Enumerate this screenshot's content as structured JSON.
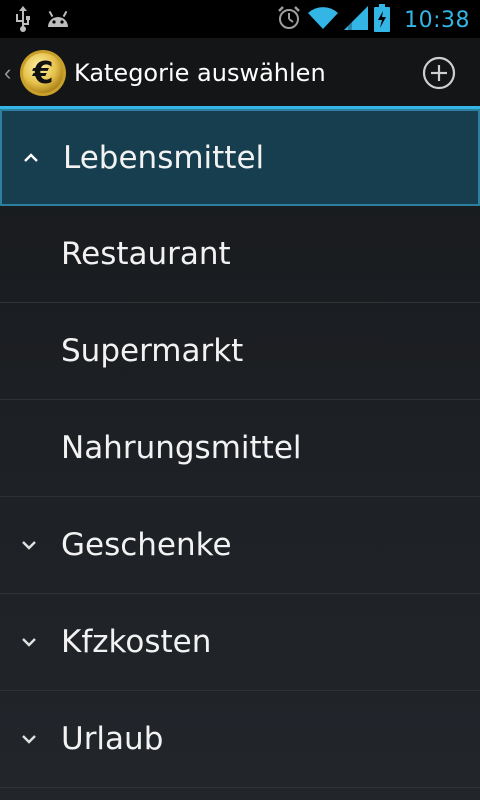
{
  "status_bar": {
    "time": "10:38",
    "left_icons": [
      "usb-icon",
      "android-icon"
    ],
    "right_icons": [
      "alarm-icon",
      "wifi-icon",
      "signal-icon",
      "battery-charging-icon"
    ]
  },
  "action_bar": {
    "title": "Kategorie auswählen",
    "app_icon": "euro-coin-icon",
    "add_icon": "add-circle-icon"
  },
  "categories": [
    {
      "label": "Lebensmittel",
      "type": "group",
      "expanded": true,
      "selected": true
    },
    {
      "label": "Restaurant",
      "type": "child"
    },
    {
      "label": "Supermarkt",
      "type": "child"
    },
    {
      "label": "Nahrungsmittel",
      "type": "child"
    },
    {
      "label": "Geschenke",
      "type": "group",
      "expanded": false
    },
    {
      "label": "Kfzkosten",
      "type": "group",
      "expanded": false
    },
    {
      "label": "Urlaub",
      "type": "group",
      "expanded": false
    }
  ],
  "colors": {
    "accent": "#33b5e5",
    "selected_bg": "#163e4e"
  }
}
